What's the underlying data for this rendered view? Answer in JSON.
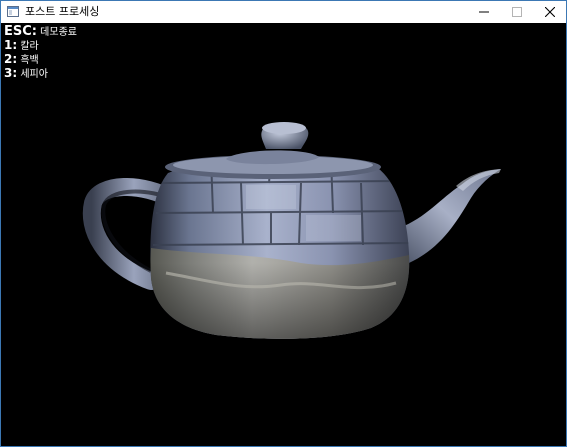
{
  "window": {
    "title": "포스트 프로세싱",
    "icon": "app-window-icon",
    "controls": [
      "minimize-icon",
      "maximize-icon",
      "close-icon"
    ]
  },
  "overlay": {
    "items": [
      {
        "key": "ESC:",
        "label": "데모종료"
      },
      {
        "key": "1:",
        "label": "칼라"
      },
      {
        "key": "2:",
        "label": "흑백"
      },
      {
        "key": "3:",
        "label": "세피아"
      }
    ]
  },
  "scene": {
    "object": "teapot",
    "background": "#000000"
  }
}
